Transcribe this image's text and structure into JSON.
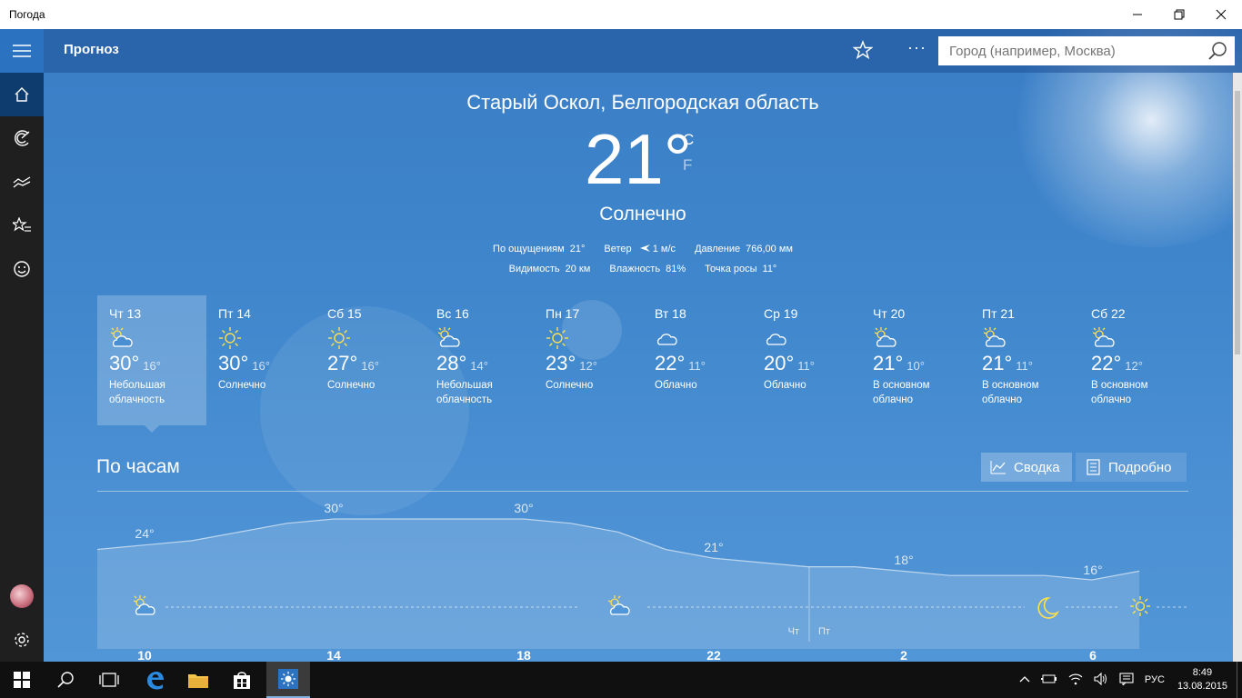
{
  "window": {
    "title": "Погода"
  },
  "appbar": {
    "title": "Прогноз",
    "search_placeholder": "Город (например, Москва)"
  },
  "current": {
    "city": "Старый Оскол, Белгородская область",
    "temperature": "21°",
    "unit_c": "C",
    "unit_f": "F",
    "condition": "Солнечно",
    "feels_like_label": "По ощущениям",
    "feels_like": "21°",
    "wind_label": "Ветер",
    "wind": "1 м/с",
    "pressure_label": "Давление",
    "pressure": "766,00 мм",
    "visibility_label": "Видимость",
    "visibility": "20 км",
    "humidity_label": "Влажность",
    "humidity": "81%",
    "dewpoint_label": "Точка росы",
    "dewpoint": "11°"
  },
  "daily": [
    {
      "day": "Чт 13",
      "hi": "30°",
      "lo": "16°",
      "cond": "Небольшая облачность",
      "icon": "partly-cloudy-icon"
    },
    {
      "day": "Пт 14",
      "hi": "30°",
      "lo": "16°",
      "cond": "Солнечно",
      "icon": "sun-icon"
    },
    {
      "day": "Сб 15",
      "hi": "27°",
      "lo": "16°",
      "cond": "Солнечно",
      "icon": "sun-icon"
    },
    {
      "day": "Вс 16",
      "hi": "28°",
      "lo": "14°",
      "cond": "Небольшая облачность",
      "icon": "partly-cloudy-icon"
    },
    {
      "day": "Пн 17",
      "hi": "23°",
      "lo": "12°",
      "cond": "Солнечно",
      "icon": "sun-icon"
    },
    {
      "day": "Вт 18",
      "hi": "22°",
      "lo": "11°",
      "cond": "Облачно",
      "icon": "cloud-icon"
    },
    {
      "day": "Ср 19",
      "hi": "20°",
      "lo": "11°",
      "cond": "Облачно",
      "icon": "cloud-icon"
    },
    {
      "day": "Чт 20",
      "hi": "21°",
      "lo": "10°",
      "cond": "В основном облачно",
      "icon": "partly-cloudy-icon"
    },
    {
      "day": "Пт 21",
      "hi": "21°",
      "lo": "11°",
      "cond": "В основном облачно",
      "icon": "partly-cloudy-icon"
    },
    {
      "day": "Сб 22",
      "hi": "22°",
      "lo": "12°",
      "cond": "В основном облачно",
      "icon": "partly-cloudy-icon"
    }
  ],
  "hourly": {
    "title": "По часам",
    "summary_label": "Сводка",
    "detail_label": "Подробно",
    "day_label_left": "Чт",
    "day_label_right": "Пт",
    "hours": [
      "10",
      "14",
      "18",
      "22",
      "2",
      "6"
    ],
    "temp_labels": [
      "24°",
      "30°",
      "30°",
      "21°",
      "18°",
      "16°"
    ]
  },
  "chart_data": {
    "type": "area",
    "x_hours": [
      9,
      10,
      11,
      12,
      13,
      14,
      15,
      16,
      17,
      18,
      19,
      20,
      21,
      22,
      23,
      0,
      1,
      2,
      3,
      4,
      5,
      6,
      7
    ],
    "values": [
      23,
      24,
      25,
      27,
      29,
      30,
      30,
      30,
      30,
      30,
      29,
      27,
      23,
      21,
      20,
      19,
      19,
      18,
      17,
      17,
      17,
      16,
      18
    ],
    "labeled_points": [
      {
        "hour": "10",
        "value": "24°"
      },
      {
        "hour": "14",
        "value": "30°"
      },
      {
        "hour": "18",
        "value": "30°"
      },
      {
        "hour": "22",
        "value": "21°"
      },
      {
        "hour": "2",
        "value": "18°"
      },
      {
        "hour": "6",
        "value": "16°"
      }
    ],
    "xlabel": "",
    "ylabel": ""
  },
  "taskbar": {
    "language": "РУС",
    "time": "8:49",
    "date": "13.08.2015"
  }
}
